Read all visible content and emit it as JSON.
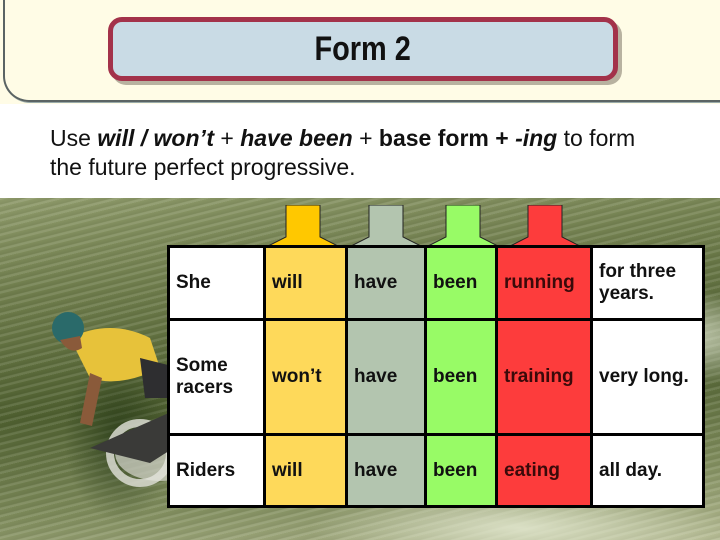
{
  "slide": {
    "title": "Form 2",
    "intro": {
      "use": "Use ",
      "will_wont": "will / won’t",
      "plus1": " + ",
      "have_been": "have been",
      "plus2": " + ",
      "base_form": "base form + ",
      "ing": "-ing",
      "to_form": " to form",
      "line2": "the future perfect progressive."
    },
    "arrows": [
      {
        "name": "will-arrow",
        "color": "#ffc800"
      },
      {
        "name": "have-arrow",
        "color": "#b3c5af"
      },
      {
        "name": "been-arrow",
        "color": "#98fb66"
      },
      {
        "name": "ing-arrow",
        "color": "#fd3c3c"
      }
    ],
    "column_colors": {
      "subject": "#ffffff",
      "modal": "#fed95a",
      "have": "#b3c5af",
      "been": "#98fb66",
      "verb_ing": "#fd3c3c",
      "complement": "#ffffff"
    },
    "rows": [
      {
        "subject": "She",
        "modal": "will",
        "have": "have",
        "been": "been",
        "verb_ing": "running",
        "complement": "for three years."
      },
      {
        "subject": "Some racers",
        "modal": "won’t",
        "have": "have",
        "been": "been",
        "verb_ing": "training",
        "complement": "very long."
      },
      {
        "subject": "Riders",
        "modal": "will",
        "have": "have",
        "been": "been",
        "verb_ing": "eating",
        "complement": "all day."
      }
    ]
  }
}
